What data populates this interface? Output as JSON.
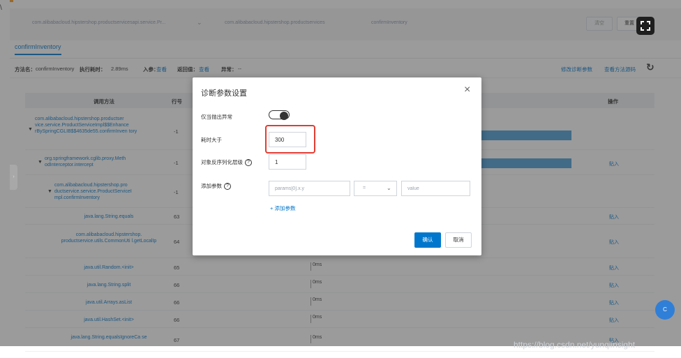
{
  "topbar": {
    "crumb_class": "com.alibabacloud.hipstershop.productservicesapi.service.Pr...",
    "crumb_project": "com.alibabacloud.hipstershop.productservices",
    "crumb_method": "confirmInventory",
    "btn1_label": "清空",
    "btn2_label": "重置"
  },
  "tab": {
    "label": "confirmInventory"
  },
  "info": {
    "method_label": "方法名：",
    "method_value": "confirmInventory",
    "time_label": "执行耗时：",
    "time_value": "2.89ms",
    "param_label": "入参：",
    "view1": "查看",
    "return_label": "返回值：",
    "view2": "查看",
    "exception_label": "异常：",
    "exception_value": "--",
    "modify_link": "修改诊断参数",
    "source_link": "查看方法源码"
  },
  "table": {
    "col_method": "调用方法",
    "col_line": "行号",
    "col_action": "操作",
    "rows": [
      {
        "method": "com.alibabacloud.hipstershop.productser vice.service.ProductServiceImpl$$Enhance rBySpringCGLIB$$4635de55.confirmInven tory",
        "line": "-1",
        "time": "",
        "action": ""
      },
      {
        "method": "org.springframework.cglib.proxy.Meth odInterceptor.intercept",
        "line": "-1",
        "time": "",
        "action": "贴入"
      },
      {
        "method": "com.alibabacloud.hipstershop.pro ductservice.service.ProductServiceI mpl.confirmInventory",
        "line": "-1",
        "time": "",
        "action": ""
      },
      {
        "method": "java.lang.String.equals",
        "line": "63",
        "time": "",
        "action": "贴入"
      },
      {
        "method": "com.alibabacloud.hipstershop. productservice.utils.CommonUti l.getLocalIp",
        "line": "64",
        "time": "",
        "action": "贴入"
      },
      {
        "method": "java.util.Random.<init>",
        "line": "65",
        "time": "0ms",
        "action": "贴入"
      },
      {
        "method": "java.lang.String.split",
        "line": "66",
        "time": "0ms",
        "action": "贴入"
      },
      {
        "method": "java.util.Arrays.asList",
        "line": "66",
        "time": "0ms",
        "action": "贴入"
      },
      {
        "method": "java.util.HashSet.<init>",
        "line": "66",
        "time": "0ms",
        "action": "贴入"
      },
      {
        "method": "java.lang.String.equalsIgnoreCa se",
        "line": "67",
        "time": "0ms",
        "action": "贴入"
      }
    ]
  },
  "modal": {
    "title": "诊断参数设置",
    "close_glyph": "×",
    "exception_only_label": "仅当抛出异常",
    "duration_label": "耗时大于",
    "duration_value": "300",
    "depth_label": "对象反序列化层级",
    "depth_value": "1",
    "add_param_label": "添加参数",
    "param_placeholder": "params[0].x.y",
    "operator_value": "=",
    "value_placeholder": "value",
    "add_param_link": "+ 添加参数",
    "confirm_label": "确认",
    "cancel_label": "取消"
  },
  "float_label": "C",
  "watermark": "https://blog.csdn.net/yunqiinsight"
}
